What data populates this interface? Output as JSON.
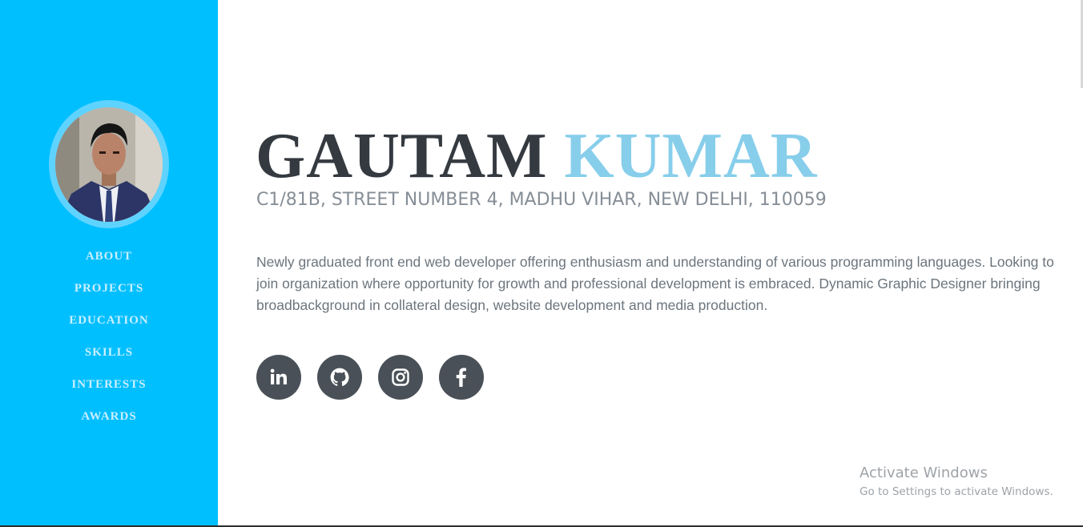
{
  "profile": {
    "photo_alt": "profile photo",
    "first_name": "GAUTAM",
    "last_name": "KUMAR",
    "address": "C1/81B, STREET NUMBER 4, MADHU VIHAR, NEW DELHI, 110059",
    "bio": "Newly graduated front end web developer offering enthusiasm and understanding of various programming languages. Looking to join organization where opportunity for growth and professional development is embraced. Dynamic Graphic Designer bringing broadbackground in collateral design, website development and media production."
  },
  "nav": {
    "items": [
      {
        "label": "ABOUT"
      },
      {
        "label": "PROJECTS"
      },
      {
        "label": "EDUCATION"
      },
      {
        "label": "SKILLS"
      },
      {
        "label": "INTERESTS"
      },
      {
        "label": "AWARDS"
      }
    ]
  },
  "social": {
    "icons": [
      "linkedin-icon",
      "github-icon",
      "instagram-icon",
      "facebook-icon"
    ]
  },
  "watermark": {
    "title": "Activate Windows",
    "subtitle": "Go to Settings to activate Windows."
  },
  "colors": {
    "sidebar": "#00bfff",
    "name_first": "#343a40",
    "name_last": "#87ceeb",
    "social_button": "#495057"
  }
}
